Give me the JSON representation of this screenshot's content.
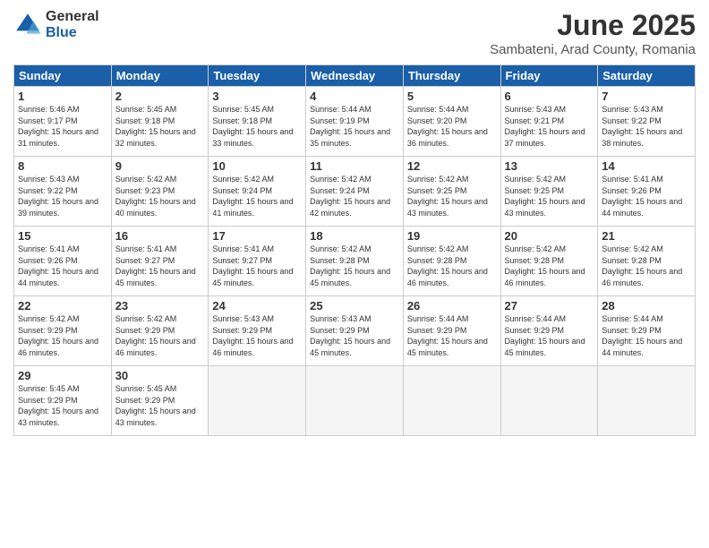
{
  "header": {
    "logo_general": "General",
    "logo_blue": "Blue",
    "month_title": "June 2025",
    "location": "Sambateni, Arad County, Romania"
  },
  "weekdays": [
    "Sunday",
    "Monday",
    "Tuesday",
    "Wednesday",
    "Thursday",
    "Friday",
    "Saturday"
  ],
  "days": [
    {
      "num": "",
      "sunrise": "",
      "sunset": "",
      "daylight": ""
    },
    {
      "num": "",
      "sunrise": "",
      "sunset": "",
      "daylight": ""
    },
    {
      "num": "",
      "sunrise": "",
      "sunset": "",
      "daylight": ""
    },
    {
      "num": "",
      "sunrise": "",
      "sunset": "",
      "daylight": ""
    },
    {
      "num": "",
      "sunrise": "",
      "sunset": "",
      "daylight": ""
    },
    {
      "num": "",
      "sunrise": "",
      "sunset": "",
      "daylight": ""
    },
    {
      "num": "",
      "sunrise": "",
      "sunset": "",
      "daylight": ""
    },
    {
      "num": "1",
      "sunrise": "Sunrise: 5:46 AM",
      "sunset": "Sunset: 9:17 PM",
      "daylight": "Daylight: 15 hours and 31 minutes."
    },
    {
      "num": "2",
      "sunrise": "Sunrise: 5:45 AM",
      "sunset": "Sunset: 9:18 PM",
      "daylight": "Daylight: 15 hours and 32 minutes."
    },
    {
      "num": "3",
      "sunrise": "Sunrise: 5:45 AM",
      "sunset": "Sunset: 9:18 PM",
      "daylight": "Daylight: 15 hours and 33 minutes."
    },
    {
      "num": "4",
      "sunrise": "Sunrise: 5:44 AM",
      "sunset": "Sunset: 9:19 PM",
      "daylight": "Daylight: 15 hours and 35 minutes."
    },
    {
      "num": "5",
      "sunrise": "Sunrise: 5:44 AM",
      "sunset": "Sunset: 9:20 PM",
      "daylight": "Daylight: 15 hours and 36 minutes."
    },
    {
      "num": "6",
      "sunrise": "Sunrise: 5:43 AM",
      "sunset": "Sunset: 9:21 PM",
      "daylight": "Daylight: 15 hours and 37 minutes."
    },
    {
      "num": "7",
      "sunrise": "Sunrise: 5:43 AM",
      "sunset": "Sunset: 9:22 PM",
      "daylight": "Daylight: 15 hours and 38 minutes."
    },
    {
      "num": "8",
      "sunrise": "Sunrise: 5:43 AM",
      "sunset": "Sunset: 9:22 PM",
      "daylight": "Daylight: 15 hours and 39 minutes."
    },
    {
      "num": "9",
      "sunrise": "Sunrise: 5:42 AM",
      "sunset": "Sunset: 9:23 PM",
      "daylight": "Daylight: 15 hours and 40 minutes."
    },
    {
      "num": "10",
      "sunrise": "Sunrise: 5:42 AM",
      "sunset": "Sunset: 9:24 PM",
      "daylight": "Daylight: 15 hours and 41 minutes."
    },
    {
      "num": "11",
      "sunrise": "Sunrise: 5:42 AM",
      "sunset": "Sunset: 9:24 PM",
      "daylight": "Daylight: 15 hours and 42 minutes."
    },
    {
      "num": "12",
      "sunrise": "Sunrise: 5:42 AM",
      "sunset": "Sunset: 9:25 PM",
      "daylight": "Daylight: 15 hours and 43 minutes."
    },
    {
      "num": "13",
      "sunrise": "Sunrise: 5:42 AM",
      "sunset": "Sunset: 9:25 PM",
      "daylight": "Daylight: 15 hours and 43 minutes."
    },
    {
      "num": "14",
      "sunrise": "Sunrise: 5:41 AM",
      "sunset": "Sunset: 9:26 PM",
      "daylight": "Daylight: 15 hours and 44 minutes."
    },
    {
      "num": "15",
      "sunrise": "Sunrise: 5:41 AM",
      "sunset": "Sunset: 9:26 PM",
      "daylight": "Daylight: 15 hours and 44 minutes."
    },
    {
      "num": "16",
      "sunrise": "Sunrise: 5:41 AM",
      "sunset": "Sunset: 9:27 PM",
      "daylight": "Daylight: 15 hours and 45 minutes."
    },
    {
      "num": "17",
      "sunrise": "Sunrise: 5:41 AM",
      "sunset": "Sunset: 9:27 PM",
      "daylight": "Daylight: 15 hours and 45 minutes."
    },
    {
      "num": "18",
      "sunrise": "Sunrise: 5:42 AM",
      "sunset": "Sunset: 9:28 PM",
      "daylight": "Daylight: 15 hours and 45 minutes."
    },
    {
      "num": "19",
      "sunrise": "Sunrise: 5:42 AM",
      "sunset": "Sunset: 9:28 PM",
      "daylight": "Daylight: 15 hours and 46 minutes."
    },
    {
      "num": "20",
      "sunrise": "Sunrise: 5:42 AM",
      "sunset": "Sunset: 9:28 PM",
      "daylight": "Daylight: 15 hours and 46 minutes."
    },
    {
      "num": "21",
      "sunrise": "Sunrise: 5:42 AM",
      "sunset": "Sunset: 9:28 PM",
      "daylight": "Daylight: 15 hours and 46 minutes."
    },
    {
      "num": "22",
      "sunrise": "Sunrise: 5:42 AM",
      "sunset": "Sunset: 9:29 PM",
      "daylight": "Daylight: 15 hours and 46 minutes."
    },
    {
      "num": "23",
      "sunrise": "Sunrise: 5:42 AM",
      "sunset": "Sunset: 9:29 PM",
      "daylight": "Daylight: 15 hours and 46 minutes."
    },
    {
      "num": "24",
      "sunrise": "Sunrise: 5:43 AM",
      "sunset": "Sunset: 9:29 PM",
      "daylight": "Daylight: 15 hours and 46 minutes."
    },
    {
      "num": "25",
      "sunrise": "Sunrise: 5:43 AM",
      "sunset": "Sunset: 9:29 PM",
      "daylight": "Daylight: 15 hours and 45 minutes."
    },
    {
      "num": "26",
      "sunrise": "Sunrise: 5:44 AM",
      "sunset": "Sunset: 9:29 PM",
      "daylight": "Daylight: 15 hours and 45 minutes."
    },
    {
      "num": "27",
      "sunrise": "Sunrise: 5:44 AM",
      "sunset": "Sunset: 9:29 PM",
      "daylight": "Daylight: 15 hours and 45 minutes."
    },
    {
      "num": "28",
      "sunrise": "Sunrise: 5:44 AM",
      "sunset": "Sunset: 9:29 PM",
      "daylight": "Daylight: 15 hours and 44 minutes."
    },
    {
      "num": "29",
      "sunrise": "Sunrise: 5:45 AM",
      "sunset": "Sunset: 9:29 PM",
      "daylight": "Daylight: 15 hours and 43 minutes."
    },
    {
      "num": "30",
      "sunrise": "Sunrise: 5:45 AM",
      "sunset": "Sunset: 9:29 PM",
      "daylight": "Daylight: 15 hours and 43 minutes."
    },
    {
      "num": "",
      "sunrise": "",
      "sunset": "",
      "daylight": ""
    },
    {
      "num": "",
      "sunrise": "",
      "sunset": "",
      "daylight": ""
    },
    {
      "num": "",
      "sunrise": "",
      "sunset": "",
      "daylight": ""
    },
    {
      "num": "",
      "sunrise": "",
      "sunset": "",
      "daylight": ""
    },
    {
      "num": "",
      "sunrise": "",
      "sunset": "",
      "daylight": ""
    }
  ]
}
